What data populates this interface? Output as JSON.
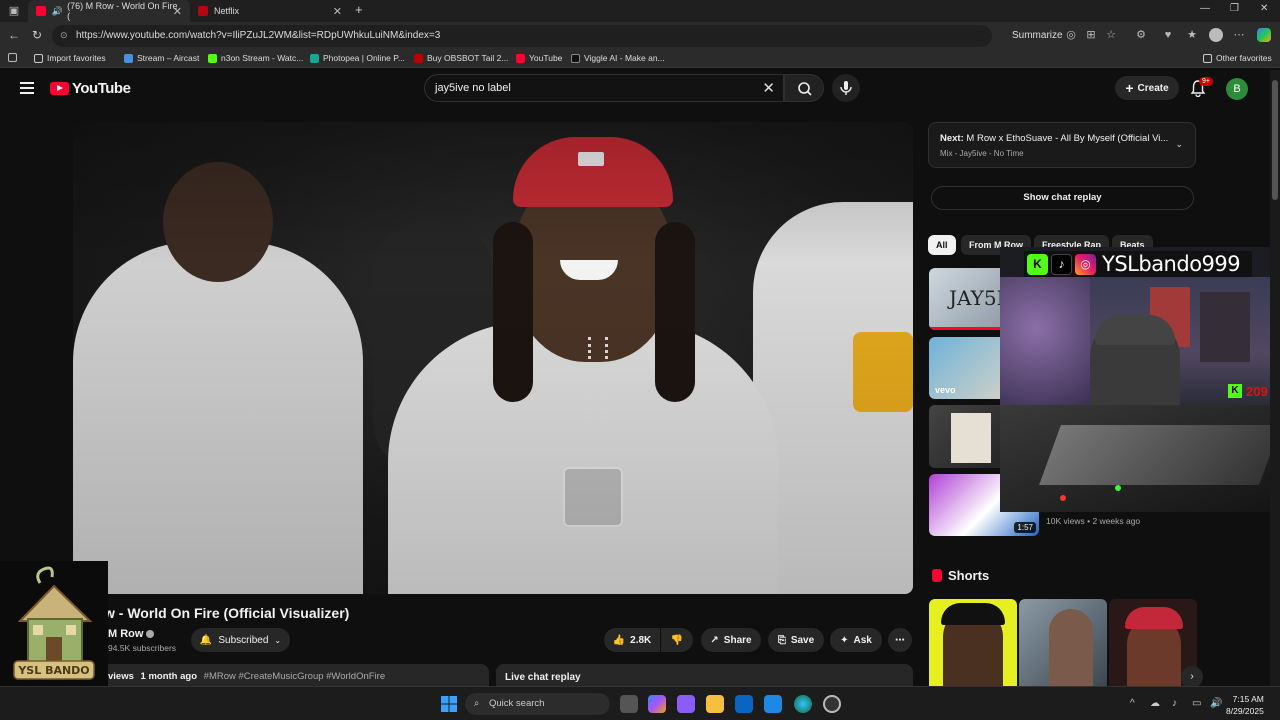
{
  "browser": {
    "tabs": [
      {
        "title": "(76) M Row - World On Fire (",
        "active": true
      },
      {
        "title": "Netflix",
        "active": false
      }
    ],
    "url": "https://www.youtube.com/watch?v=IliPZuJL2WM&list=RDpUWhkuLuiNM&index=3",
    "summarize_label": "Summarize",
    "favorites": [
      "Import favorites",
      "Stream – Aircast",
      "n3on Stream - Watc...",
      "Photopea | Online P...",
      "Buy OBSBOT Tail 2...",
      "YouTube",
      "Viggle AI - Make an..."
    ],
    "other_favorites": "Other favorites"
  },
  "youtube": {
    "logo_text": "YouTube",
    "search_value": "jay5ive no label",
    "create_label": "Create",
    "notif_badge": "9+",
    "avatar_letter": "B"
  },
  "video": {
    "title": "w - World On Fire (Official Visualizer)",
    "channel": "M Row",
    "subscribers": "94.5K subscribers",
    "subscribe_label": "Subscribed",
    "likes": "2.8K",
    "share_label": "Share",
    "save_label": "Save",
    "ask_label": "Ask",
    "desc_views": "views",
    "desc_date": "1 month ago",
    "desc_tags": "#MRow #CreateMusicGroup #WorldOnFire",
    "live_chat_label": "Live chat replay"
  },
  "sidebar": {
    "next_prefix": "Next:",
    "next_title": "M Row x EthoSuave - All By Myself (Official Vi...",
    "next_sub": "Mix - Jay5ive - No Time",
    "show_chat": "Show chat replay",
    "chips": [
      "All",
      "From M Row",
      "Freestyle Rap",
      "Beats"
    ],
    "thumb1_text": "JAY5I",
    "thumb2_text": "vevo",
    "thumb4_duration": "1:57",
    "thumb4_meta": "10K views • 2 weeks ago",
    "shorts_label": "Shorts"
  },
  "overlay": {
    "name": "YSLbando999",
    "kick_count": "209"
  },
  "brand": {
    "logo_text": "YSL BANDO"
  },
  "taskbar": {
    "search_placeholder": "Quick search",
    "time": "7:15 AM",
    "date": "8/29/2025"
  }
}
